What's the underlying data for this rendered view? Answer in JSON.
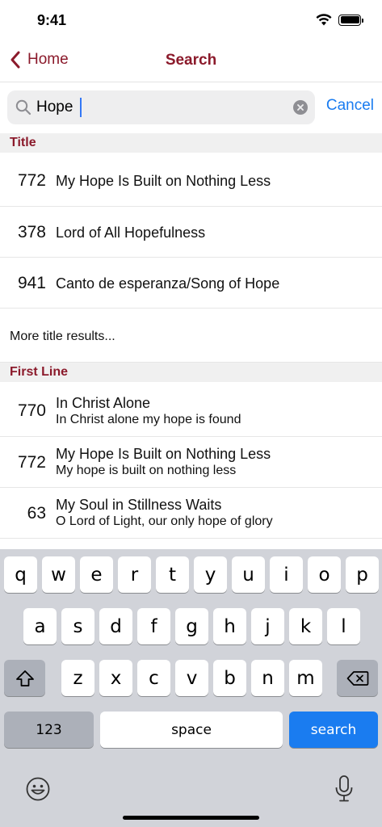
{
  "status": {
    "time": "9:41"
  },
  "nav": {
    "back_label": "Home",
    "title": "Search"
  },
  "search": {
    "value": "Hope",
    "cancel_label": "Cancel"
  },
  "sections": {
    "title": {
      "header": "Title",
      "rows": [
        {
          "number": "772",
          "title": "My Hope Is Built on Nothing Less"
        },
        {
          "number": "378",
          "title": "Lord of All Hopefulness"
        },
        {
          "number": "941",
          "title": "Canto de esperanza/Song of Hope"
        }
      ],
      "more_label": "More title results..."
    },
    "first_line": {
      "header": "First Line",
      "rows": [
        {
          "number": "770",
          "title": "In Christ Alone",
          "line": "In Christ alone my hope is found"
        },
        {
          "number": "772",
          "title": "My Hope Is Built on Nothing Less",
          "line": "My hope is built on nothing less"
        },
        {
          "number": "63",
          "title": "My Soul in Stillness Waits",
          "line": "O Lord of Light, our only hope of glory"
        }
      ]
    }
  },
  "keyboard": {
    "row1": [
      "q",
      "w",
      "e",
      "r",
      "t",
      "y",
      "u",
      "i",
      "o",
      "p"
    ],
    "row2": [
      "a",
      "s",
      "d",
      "f",
      "g",
      "h",
      "j",
      "k",
      "l"
    ],
    "row3": [
      "z",
      "x",
      "c",
      "v",
      "b",
      "n",
      "m"
    ],
    "numbers_label": "123",
    "space_label": "space",
    "search_label": "search"
  },
  "colors": {
    "accent": "#8b1a2b",
    "link": "#1a7cf0"
  }
}
